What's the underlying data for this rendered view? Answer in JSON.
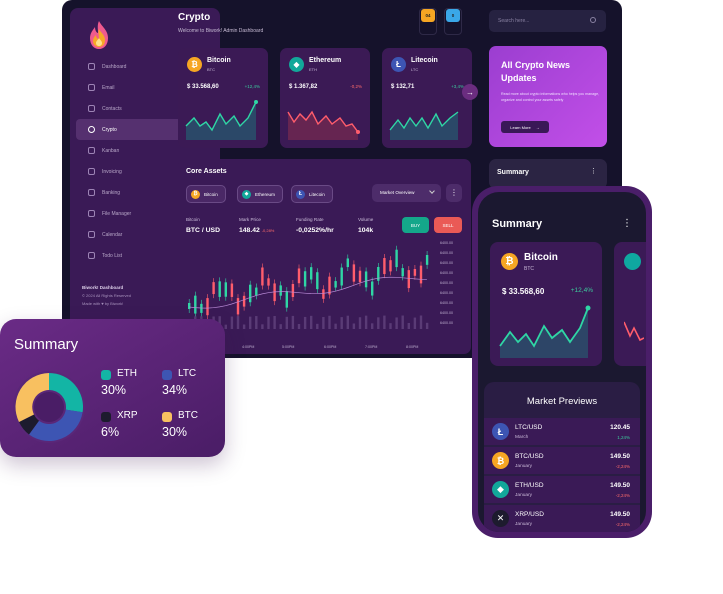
{
  "app": {
    "title": "Crypto",
    "subtitle": "Welcome to Biwork! Admin Dashboard",
    "notif_badge_1": "04",
    "notif_badge_2": "0",
    "search_placeholder": "Search here..."
  },
  "sidebar": {
    "items": [
      {
        "label": "Dashboard"
      },
      {
        "label": "Email"
      },
      {
        "label": "Contacts"
      },
      {
        "label": "Crypto"
      },
      {
        "label": "Kanban"
      },
      {
        "label": "Invoicing"
      },
      {
        "label": "Banking"
      },
      {
        "label": "File Manager"
      },
      {
        "label": "Calendar"
      },
      {
        "label": "Todo List"
      }
    ],
    "footer_brand": "Biwork! Dashboard",
    "footer_rights": "© 2024 All Rights Reserved",
    "footer_made": "Made with ♥ by Biwork!"
  },
  "coins": [
    {
      "name": "Bitcoin",
      "symbol": "BTC",
      "price": "$ 33.568,60",
      "change": "+12,4%",
      "color": "#f6a623",
      "glyph": "₿",
      "up": true
    },
    {
      "name": "Ethereum",
      "symbol": "ETH",
      "price": "$ 1.367,82",
      "change": "-0,2%",
      "color": "#12a89a",
      "glyph": "◆",
      "up": false
    },
    {
      "name": "Litecoin",
      "symbol": "LTC",
      "price": "$ 132,71",
      "change": "+3,4%",
      "color": "#3d55b3",
      "glyph": "Ł",
      "up": true
    }
  ],
  "news": {
    "title": "All Crypto News Updates",
    "text": "Read more about crypto informations who helps you manage, organize and control your assets safely",
    "button": "Learn More"
  },
  "core_assets": {
    "title": "Core Assets",
    "pills": [
      "Bitcoin",
      "Ethereum",
      "Litecoin"
    ],
    "select": "Market Overview",
    "stats": [
      {
        "label": "Bitcoin",
        "value": "BTC / USD"
      },
      {
        "label": "Mark Price",
        "value": "148.42",
        "delta": "-0,28%"
      },
      {
        "label": "Funding Rate",
        "value": "-0,0252%/hr"
      },
      {
        "label": "Volume",
        "value": "104k"
      }
    ],
    "buy": "BUY",
    "sell": "SELL",
    "y_ticks": [
      "6400.00",
      "6400.00",
      "6400.00",
      "6400.00",
      "6400.00",
      "6400.00",
      "6400.00",
      "6400.00",
      "6400.00"
    ],
    "x_ticks": [
      "4:00PM",
      "5:00PM",
      "6:00PM",
      "7:00PM",
      "8:00PM"
    ]
  },
  "right_summary": {
    "title": "Summary"
  },
  "summary_card": {
    "title": "Summary",
    "legend": [
      {
        "name": "ETH",
        "value": "30%",
        "color": "#13b5a5"
      },
      {
        "name": "LTC",
        "value": "34%",
        "color": "#3d55b3"
      },
      {
        "name": "XRP",
        "value": "6%",
        "color": "#1d1b2e"
      },
      {
        "name": "BTC",
        "value": "30%",
        "color": "#f8c060"
      }
    ]
  },
  "phone": {
    "title": "Summary",
    "coin": {
      "name": "Bitcoin",
      "symbol": "BTC",
      "price": "$ 33.568,60",
      "change": "+12,4%"
    },
    "market_title": "Market Previews",
    "market": [
      {
        "pair": "LTC/USD",
        "month": "March",
        "price": "120.45",
        "change": "1,24%",
        "color": "#3d55b3",
        "glyph": "Ł",
        "up": true
      },
      {
        "pair": "BTC/USD",
        "month": "January",
        "price": "149.50",
        "change": "-2,24%",
        "color": "#f6a623",
        "glyph": "₿",
        "up": false
      },
      {
        "pair": "ETH/USD",
        "month": "January",
        "price": "149.50",
        "change": "-2,24%",
        "color": "#12a89a",
        "glyph": "◆",
        "up": false
      },
      {
        "pair": "XRP/USD",
        "month": "January",
        "price": "149.50",
        "change": "-2,24%",
        "color": "#1d1b2e",
        "glyph": "✕",
        "up": false
      }
    ]
  }
}
